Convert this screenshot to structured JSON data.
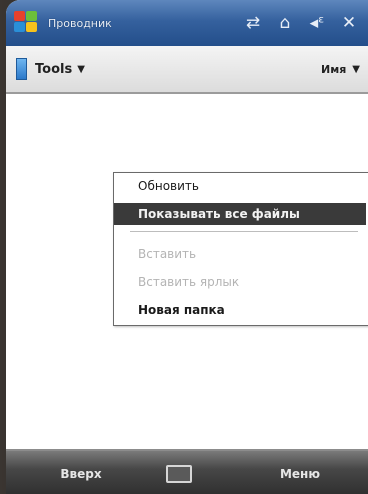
{
  "title_bar": {
    "app_title": "Проводник",
    "icons": [
      "connectivity-icon",
      "signal-icon",
      "volume-icon",
      "close-icon"
    ]
  },
  "menu_bar": {
    "folder_label": "Tools",
    "sort_label": "Имя"
  },
  "context_menu": {
    "items": [
      {
        "label": "Обновить",
        "state": "normal"
      },
      {
        "label": "Показывать все файлы",
        "state": "selected"
      },
      {
        "label": "Вставить",
        "state": "disabled"
      },
      {
        "label": "Вставить ярлык",
        "state": "disabled"
      },
      {
        "label": "Новая папка",
        "state": "normal"
      }
    ]
  },
  "soft_keys": {
    "left": "Вверх",
    "right": "Меню",
    "center_icon": "keyboard-icon"
  }
}
